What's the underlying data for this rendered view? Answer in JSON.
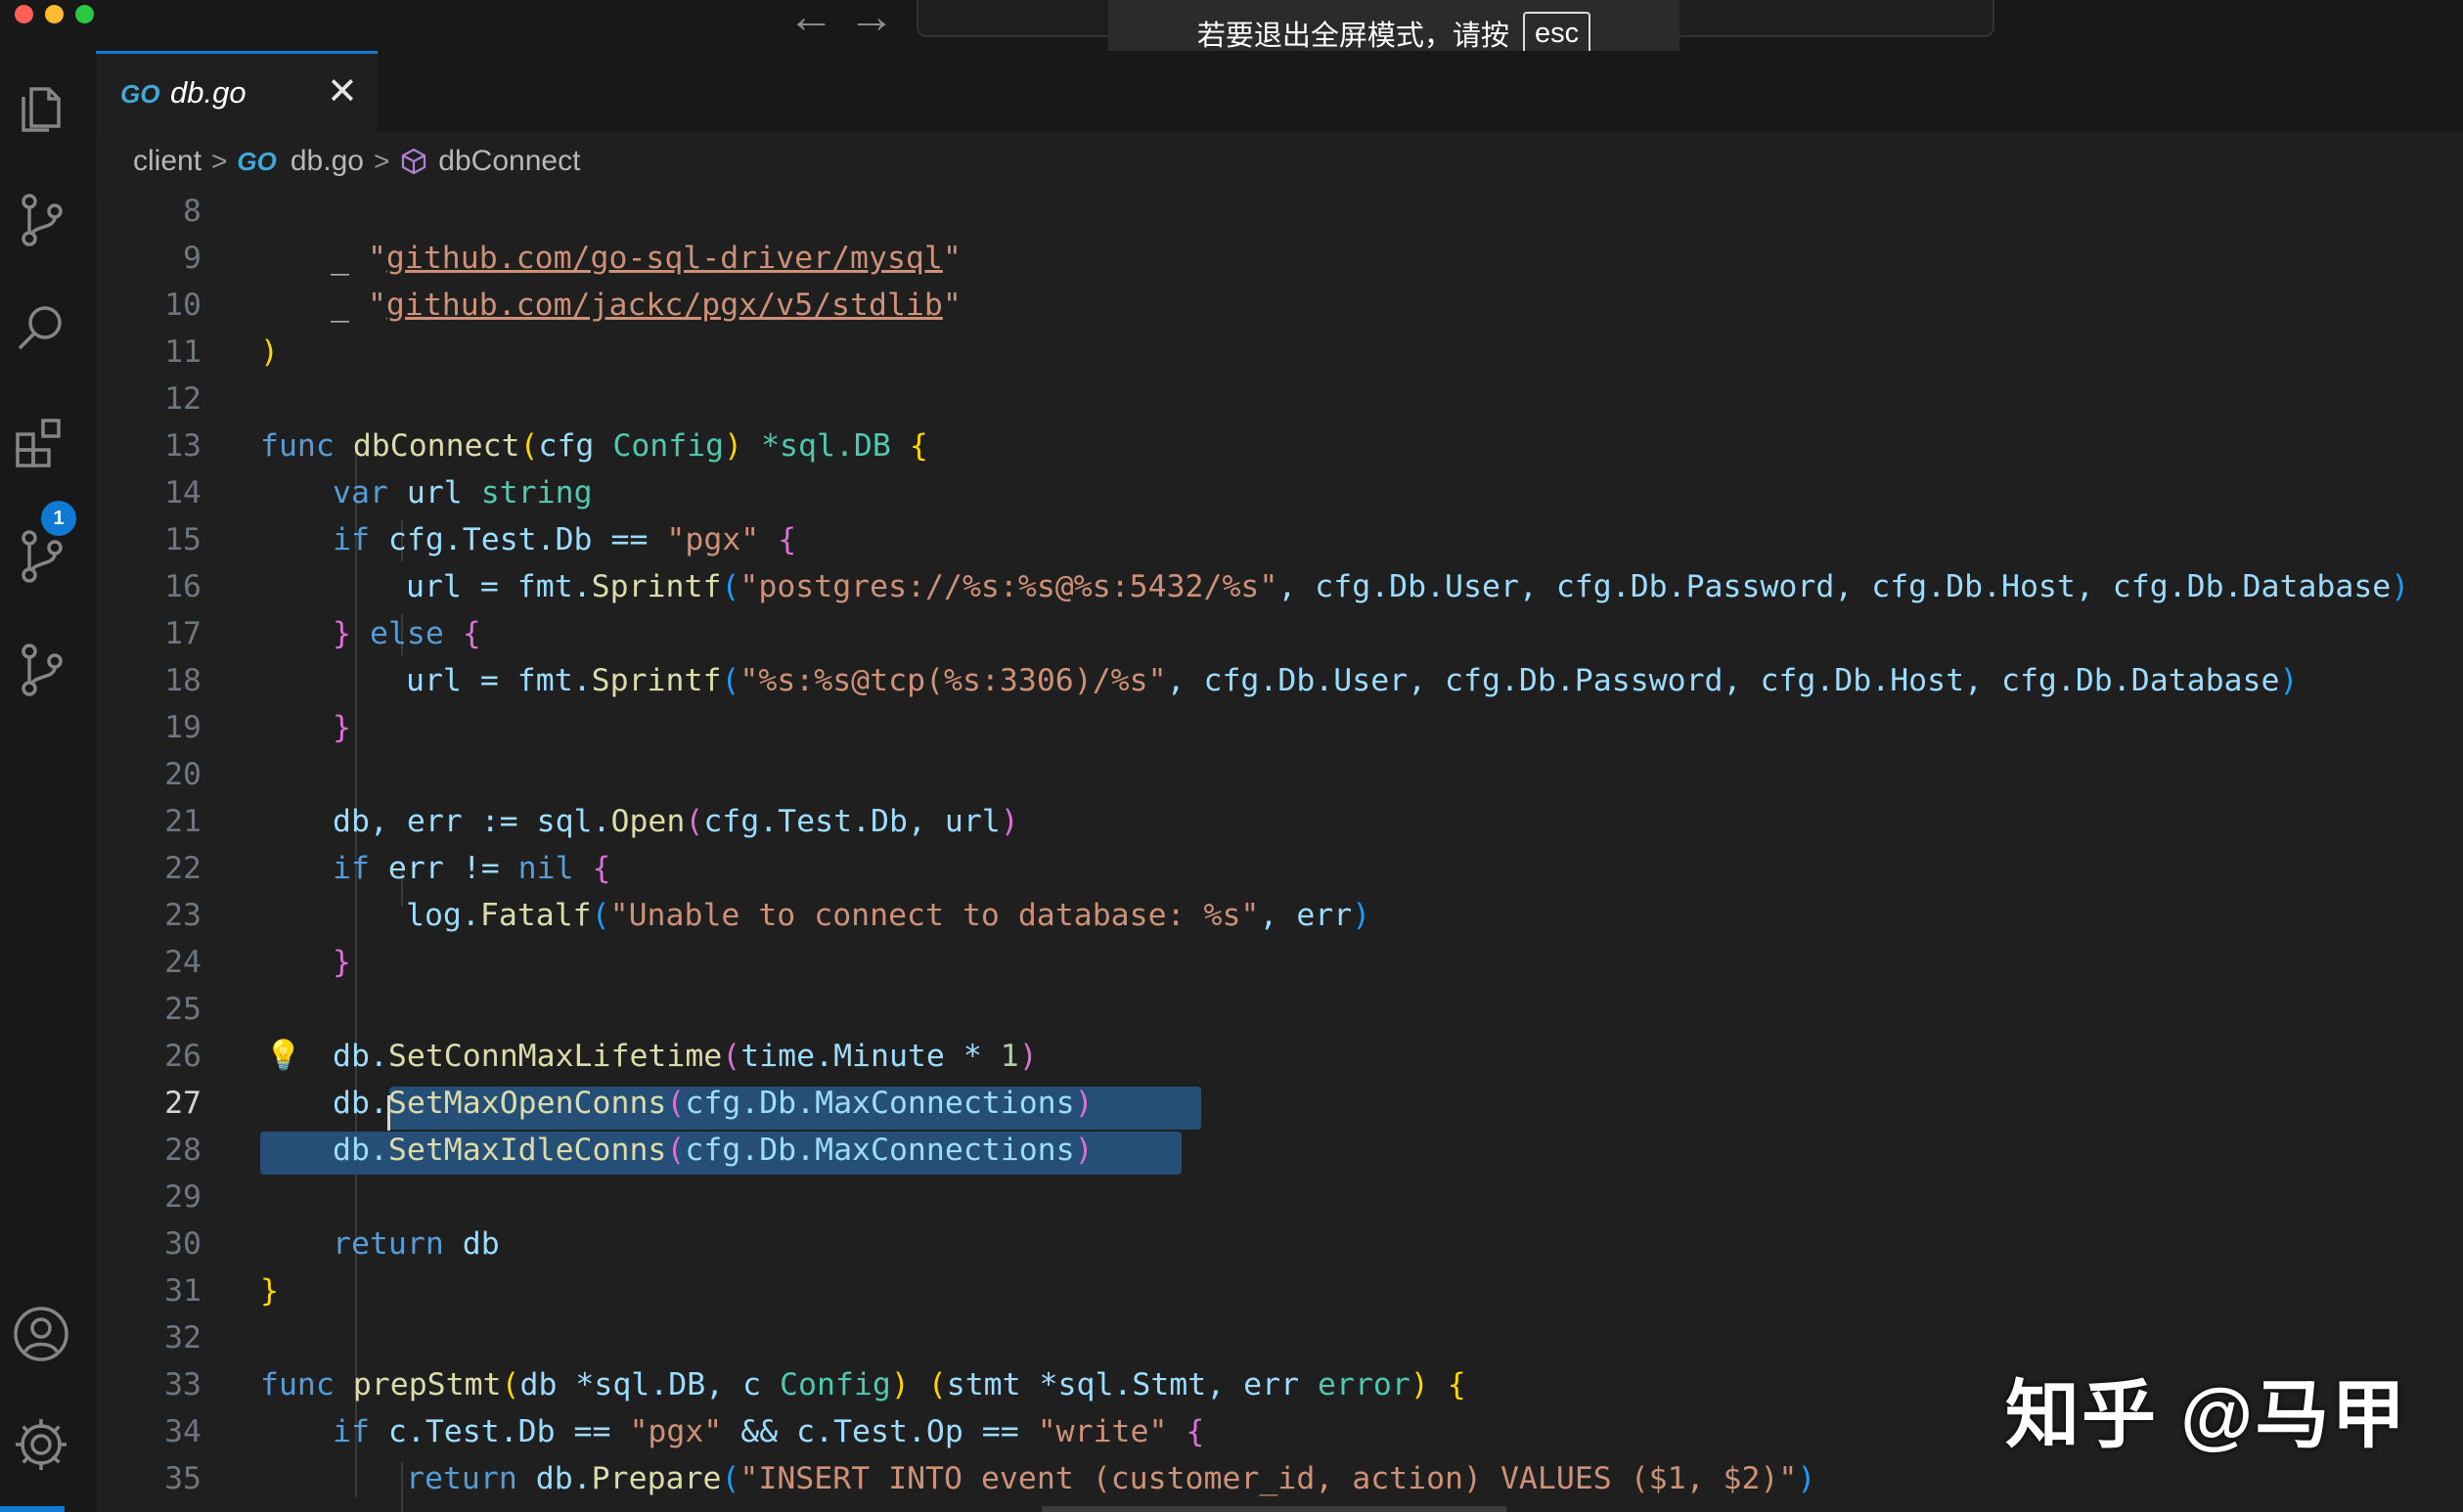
{
  "window": {
    "traffic_lights": [
      "#ff5f57",
      "#febc2e",
      "#28c840"
    ],
    "fullscreen_notice": "若要退出全屏模式，请按",
    "fullscreen_key": "esc"
  },
  "activity_bar": {
    "items": [
      "files-icon",
      "source-control-icon",
      "search-icon",
      "extensions-icon",
      "source-control-icon",
      "source-control-icon"
    ],
    "extensions_badge": "1",
    "bottom": [
      "account-icon",
      "settings-gear-icon"
    ]
  },
  "tab": {
    "icon": "GO",
    "label": "db.go",
    "close": "✕"
  },
  "breadcrumb": {
    "folder": "client",
    "file_icon": "GO",
    "file": "db.go",
    "symbol": "dbConnect"
  },
  "editor": {
    "active_line": "27",
    "line_numbers": [
      "8",
      "9",
      "10",
      "11",
      "12",
      "13",
      "14",
      "15",
      "16",
      "17",
      "18",
      "19",
      "20",
      "21",
      "22",
      "23",
      "24",
      "25",
      "26",
      "27",
      "28",
      "29",
      "30",
      "31",
      "32",
      "33",
      "34",
      "35"
    ]
  },
  "code": {
    "l9_blank": "_ ",
    "l9_q1": "\"",
    "l9_url": "github.com/go-sql-driver/mysql",
    "l9_q2": "\"",
    "l10_blank": "_ ",
    "l10_q1": "\"",
    "l10_url": "github.com/jackc/pgx/v5/stdlib",
    "l10_q2": "\"",
    "l11_paren": ")",
    "l13_func": "func",
    "l13_name": "dbConnect",
    "l13_p1": "(",
    "l13_param": "cfg",
    "l13_type": "Config",
    "l13_p2": ")",
    "l13_ret": "*sql.DB",
    "l13_brace": "{",
    "l14_var": "var",
    "l14_name": "url",
    "l14_type": "string",
    "l15_if": "if",
    "l15_expr": "cfg.Test.Db == ",
    "l15_str": "\"pgx\"",
    "l15_brace": "{",
    "l16_lhs": "url = fmt.",
    "l16_fn": "Sprintf",
    "l16_p1": "(",
    "l16_str": "\"postgres://%s:%s@%s:5432/%s\"",
    "l16_args": ", cfg.Db.User, cfg.Db.Password, cfg.Db.Host, cfg.Db.Database",
    "l16_p2": ")",
    "l17_b1": "}",
    "l17_else": "else",
    "l17_b2": "{",
    "l18_lhs": "url = fmt.",
    "l18_fn": "Sprintf",
    "l18_p1": "(",
    "l18_str": "\"%s:%s@tcp(%s:3306)/%s\"",
    "l18_args": ", cfg.Db.User, cfg.Db.Password, cfg.Db.Host, cfg.Db.Database",
    "l18_p2": ")",
    "l19_brace": "}",
    "l21_lhs": "db, err := sql.",
    "l21_fn": "Open",
    "l21_p1": "(",
    "l21_args": "cfg.Test.Db, url",
    "l21_p2": ")",
    "l22_if": "if",
    "l22_expr": "err != ",
    "l22_nil": "nil",
    "l22_brace": "{",
    "l23_obj": "log.",
    "l23_fn": "Fatalf",
    "l23_p1": "(",
    "l23_str": "\"Unable to connect to database: %s\"",
    "l23_args": ", err",
    "l23_p2": ")",
    "l24_brace": "}",
    "l26_obj": "db.",
    "l26_fn": "SetConnMaxLifetime",
    "l26_p1": "(",
    "l26_args": "time.Minute * ",
    "l26_num": "1",
    "l26_p2": ")",
    "l27_obj": "db.",
    "l27_fn": "SetMaxOpenConns",
    "l27_p1": "(",
    "l27_args": "cfg.Db.MaxConnections",
    "l27_p2": ")",
    "l28_obj": "db.",
    "l28_fn": "SetMaxIdleConns",
    "l28_p1": "(",
    "l28_args": "cfg.Db.MaxConnections",
    "l28_p2": ")",
    "l30_return": "return",
    "l30_val": "db",
    "l31_brace": "}",
    "l33_func": "func",
    "l33_name": "prepStmt",
    "l33_p1": "(",
    "l33_params": "db *sql.DB, c ",
    "l33_type": "Config",
    "l33_p2": ")",
    "l33_p3": "(",
    "l33_rets": "stmt *sql.Stmt, err ",
    "l33_err": "error",
    "l33_p4": ")",
    "l33_brace": "{",
    "l34_if": "if",
    "l34_expr1": "c.Test.Db == ",
    "l34_s1": "\"pgx\"",
    "l34_expr2": " && c.Test.Op == ",
    "l34_s2": "\"write\"",
    "l34_brace": "{",
    "l35_return": "return",
    "l35_obj": "db.",
    "l35_fn": "Prepare",
    "l35_p1": "(",
    "l35_str": "\"INSERT INTO event (customer_id, action) VALUES ($1, $2)\"",
    "l35_p2": ")"
  },
  "watermark": "知乎 @马甲"
}
